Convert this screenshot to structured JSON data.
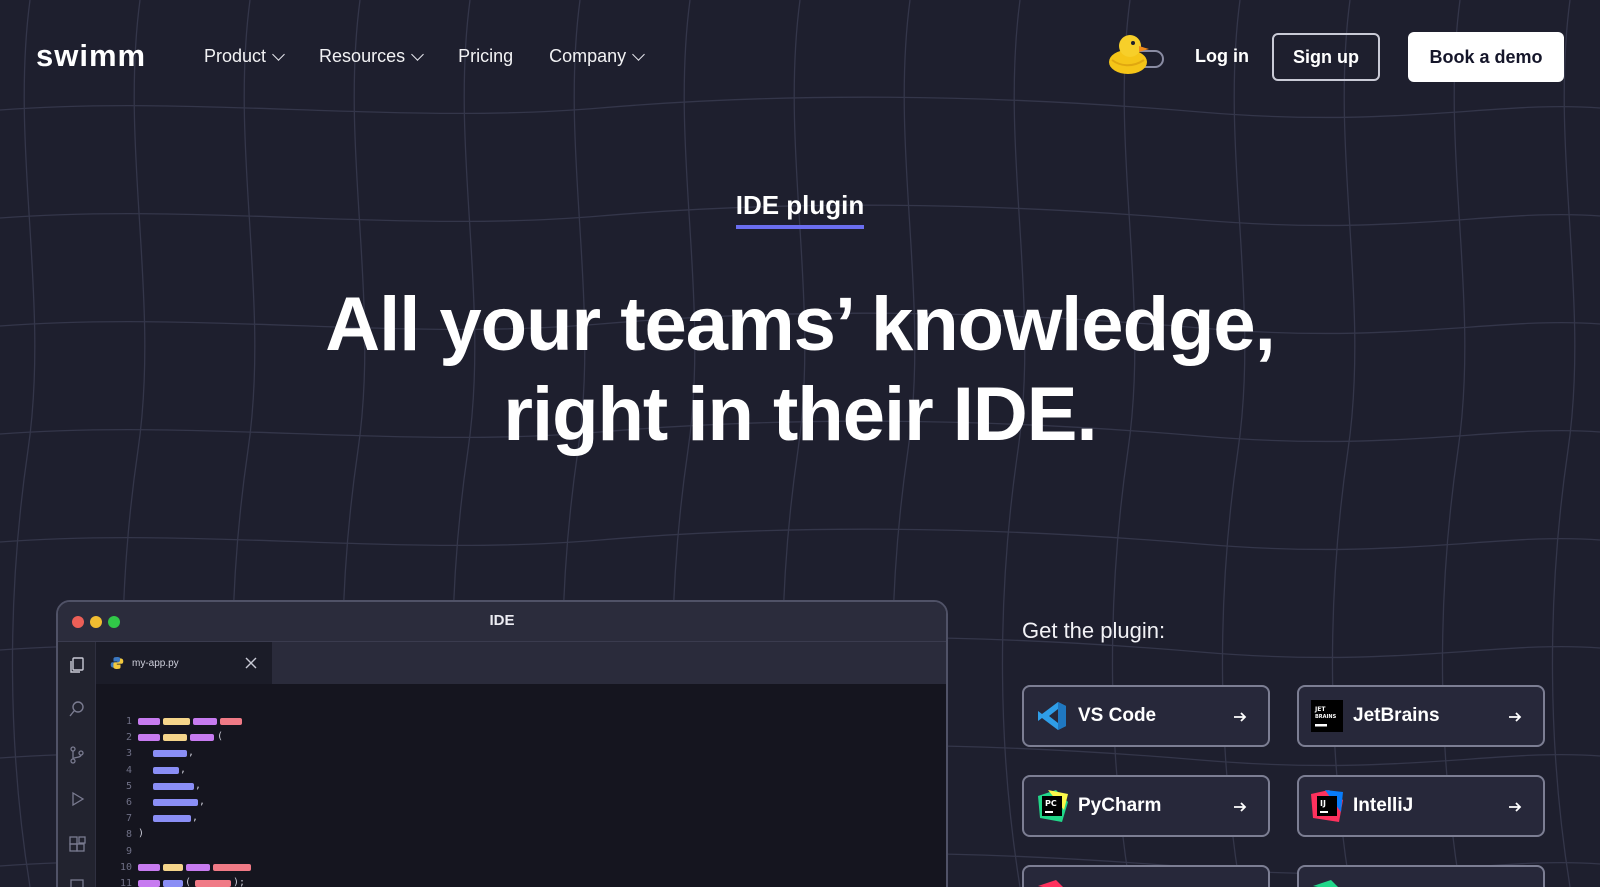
{
  "nav": {
    "logo": "swimm",
    "menu": [
      {
        "label": "Product",
        "has_dropdown": true
      },
      {
        "label": "Resources",
        "has_dropdown": true
      },
      {
        "label": "Pricing",
        "has_dropdown": false
      },
      {
        "label": "Company",
        "has_dropdown": true
      }
    ],
    "login": "Log in",
    "signup": "Sign up",
    "demo": "Book a demo"
  },
  "hero": {
    "eyebrow": "IDE plugin",
    "headline_line1": "All your teams’ knowledge,",
    "headline_line2": "right in their IDE."
  },
  "ide": {
    "title": "IDE",
    "tab_filename": "my-app.py",
    "line_numbers": [
      "1",
      "2",
      "3",
      "4",
      "5",
      "6",
      "7",
      "8",
      "9",
      "10",
      "11"
    ]
  },
  "plugins": {
    "title": "Get the plugin:",
    "items": [
      {
        "label": "VS Code",
        "icon": "vscode-icon"
      },
      {
        "label": "JetBrains",
        "icon": "jetbrains-icon"
      },
      {
        "label": "PyCharm",
        "icon": "pycharm-icon"
      },
      {
        "label": "IntelliJ",
        "icon": "intellij-icon"
      }
    ]
  },
  "colors": {
    "background": "#1e1f2e",
    "accent_underline": "#6b6ef0",
    "code_purple": "#c77bf0",
    "code_yellow": "#f5d58a",
    "code_red": "#f07a86",
    "code_blue": "#8a8ef5"
  }
}
